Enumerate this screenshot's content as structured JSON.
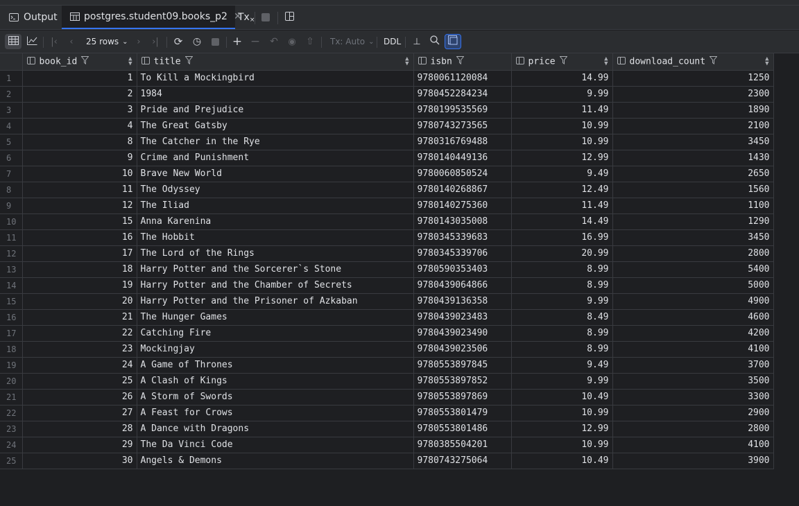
{
  "tabs": [
    {
      "label": "Output",
      "icon": "terminal-icon"
    },
    {
      "label": "postgres.student09.books_p2",
      "icon": "table-icon",
      "active": true
    },
    {
      "label": "Tx",
      "icon": "tx-icon"
    }
  ],
  "toolbar": {
    "rows_label": "25 rows",
    "tx_label": "Tx: Auto",
    "ddl_label": "DDL"
  },
  "columns": [
    "book_id",
    "title",
    "isbn",
    "price",
    "download_count"
  ],
  "rows": [
    {
      "n": "1",
      "book_id": "1",
      "title": "To Kill a Mockingbird",
      "isbn": "9780061120084",
      "price": "14.99",
      "download_count": "1250"
    },
    {
      "n": "2",
      "book_id": "2",
      "title": "1984",
      "isbn": "9780452284234",
      "price": "9.99",
      "download_count": "2300"
    },
    {
      "n": "3",
      "book_id": "3",
      "title": "Pride and Prejudice",
      "isbn": "9780199535569",
      "price": "11.49",
      "download_count": "1890"
    },
    {
      "n": "4",
      "book_id": "4",
      "title": "The Great Gatsby",
      "isbn": "9780743273565",
      "price": "10.99",
      "download_count": "2100"
    },
    {
      "n": "5",
      "book_id": "8",
      "title": "The Catcher in the Rye",
      "isbn": "9780316769488",
      "price": "10.99",
      "download_count": "3450"
    },
    {
      "n": "6",
      "book_id": "9",
      "title": "Crime and Punishment",
      "isbn": "9780140449136",
      "price": "12.99",
      "download_count": "1430"
    },
    {
      "n": "7",
      "book_id": "10",
      "title": "Brave New World",
      "isbn": "9780060850524",
      "price": "9.49",
      "download_count": "2650"
    },
    {
      "n": "8",
      "book_id": "11",
      "title": "The Odyssey",
      "isbn": "9780140268867",
      "price": "12.49",
      "download_count": "1560"
    },
    {
      "n": "9",
      "book_id": "12",
      "title": "The Iliad",
      "isbn": "9780140275360",
      "price": "11.49",
      "download_count": "1100"
    },
    {
      "n": "10",
      "book_id": "15",
      "title": "Anna Karenina",
      "isbn": "9780143035008",
      "price": "14.49",
      "download_count": "1290"
    },
    {
      "n": "11",
      "book_id": "16",
      "title": "The Hobbit",
      "isbn": "9780345339683",
      "price": "16.99",
      "download_count": "3450"
    },
    {
      "n": "12",
      "book_id": "17",
      "title": "The Lord of the Rings",
      "isbn": "9780345339706",
      "price": "20.99",
      "download_count": "2800"
    },
    {
      "n": "13",
      "book_id": "18",
      "title": "Harry Potter and the Sorcerer`s Stone",
      "isbn": "9780590353403",
      "price": "8.99",
      "download_count": "5400"
    },
    {
      "n": "14",
      "book_id": "19",
      "title": "Harry Potter and the Chamber of Secrets",
      "isbn": "9780439064866",
      "price": "8.99",
      "download_count": "5000"
    },
    {
      "n": "15",
      "book_id": "20",
      "title": "Harry Potter and the Prisoner of Azkaban",
      "isbn": "9780439136358",
      "price": "9.99",
      "download_count": "4900"
    },
    {
      "n": "16",
      "book_id": "21",
      "title": "The Hunger Games",
      "isbn": "9780439023483",
      "price": "8.49",
      "download_count": "4600"
    },
    {
      "n": "17",
      "book_id": "22",
      "title": "Catching Fire",
      "isbn": "9780439023490",
      "price": "8.99",
      "download_count": "4200"
    },
    {
      "n": "18",
      "book_id": "23",
      "title": "Mockingjay",
      "isbn": "9780439023506",
      "price": "8.99",
      "download_count": "4100"
    },
    {
      "n": "19",
      "book_id": "24",
      "title": "A Game of Thrones",
      "isbn": "9780553897845",
      "price": "9.49",
      "download_count": "3700"
    },
    {
      "n": "20",
      "book_id": "25",
      "title": "A Clash of Kings",
      "isbn": "9780553897852",
      "price": "9.99",
      "download_count": "3500"
    },
    {
      "n": "21",
      "book_id": "26",
      "title": "A Storm of Swords",
      "isbn": "9780553897869",
      "price": "10.49",
      "download_count": "3300"
    },
    {
      "n": "22",
      "book_id": "27",
      "title": "A Feast for Crows",
      "isbn": "9780553801479",
      "price": "10.99",
      "download_count": "2900"
    },
    {
      "n": "23",
      "book_id": "28",
      "title": "A Dance with Dragons",
      "isbn": "9780553801486",
      "price": "12.99",
      "download_count": "2800"
    },
    {
      "n": "24",
      "book_id": "29",
      "title": "The Da Vinci Code",
      "isbn": "9780385504201",
      "price": "10.99",
      "download_count": "4100"
    },
    {
      "n": "25",
      "book_id": "30",
      "title": "Angels & Demons",
      "isbn": "9780743275064",
      "price": "10.49",
      "download_count": "3900"
    }
  ],
  "colors": {
    "background": "#1e1f22",
    "panel": "#2b2d30",
    "border": "#393b40",
    "accent": "#3574f0",
    "text": "#dfe1e5",
    "muted": "#6f737a"
  }
}
